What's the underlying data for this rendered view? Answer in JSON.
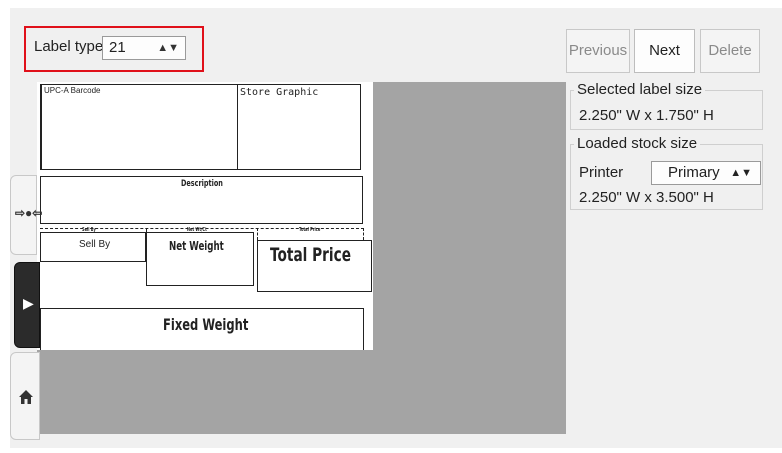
{
  "label_type": {
    "label": "Label type",
    "value": "21"
  },
  "label": {
    "upc": "UPC-A Barcode",
    "store_graphic": "Store Graphic",
    "description": "Description",
    "sell_by_small": "Sell By",
    "net_wt_small": "Net Wt/Ct",
    "total_price_small": "Total Price",
    "sell_by": "Sell By",
    "net_weight": "Net Weight",
    "total_price": "Total Price",
    "fixed_weight": "Fixed Weight"
  },
  "nav": {
    "previous": "Previous",
    "next": "Next",
    "delete": "Delete"
  },
  "selected_size": {
    "title": "Selected label size",
    "value": "2.250\" W x 1.750\" H"
  },
  "loaded_stock": {
    "title": "Loaded stock size",
    "printer_label": "Printer",
    "printer_value": "Primary",
    "value": "2.250\" W x 3.500\" H"
  },
  "icons": {
    "fit": "fit-width-icon",
    "play": "play-icon",
    "home": "home-icon"
  }
}
